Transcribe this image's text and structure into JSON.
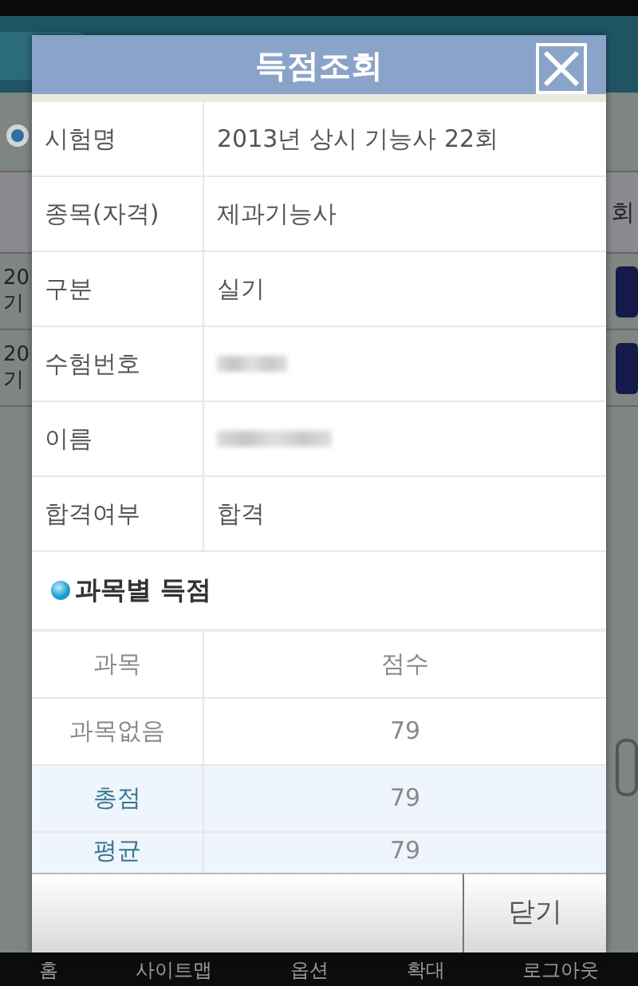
{
  "background": {
    "table": {
      "header_fragment": "회",
      "rows": [
        {
          "line_1": "20",
          "line_2": "기"
        },
        {
          "line_1": "20",
          "line_2": "기"
        }
      ]
    }
  },
  "dialog": {
    "title": "득점조회",
    "info_rows": [
      {
        "label": "시험명",
        "value": "2013년 상시 기능사 22회",
        "blurred": false
      },
      {
        "label": "종목(자격)",
        "value": "제과기능사",
        "blurred": false
      },
      {
        "label": "구분",
        "value": "실기",
        "blurred": false
      },
      {
        "label": "수험번호",
        "blurred": true
      },
      {
        "label": "이름",
        "blurred": true
      },
      {
        "label": "합격여부",
        "value": "합격",
        "blurred": false
      }
    ],
    "section_title": "과목별 득점",
    "score_table": {
      "columns": [
        "과목",
        "점수"
      ],
      "rows": [
        {
          "kind": "subject",
          "subject": "과목없음",
          "score": "79"
        },
        {
          "kind": "total",
          "subject": "총점",
          "score": "79"
        },
        {
          "kind": "total",
          "subject": "평균",
          "score": "79"
        }
      ]
    },
    "close_button": "닫기"
  },
  "bottom_nav": [
    "홈",
    "사이트맵",
    "옵션",
    "확대",
    "로그아웃"
  ]
}
